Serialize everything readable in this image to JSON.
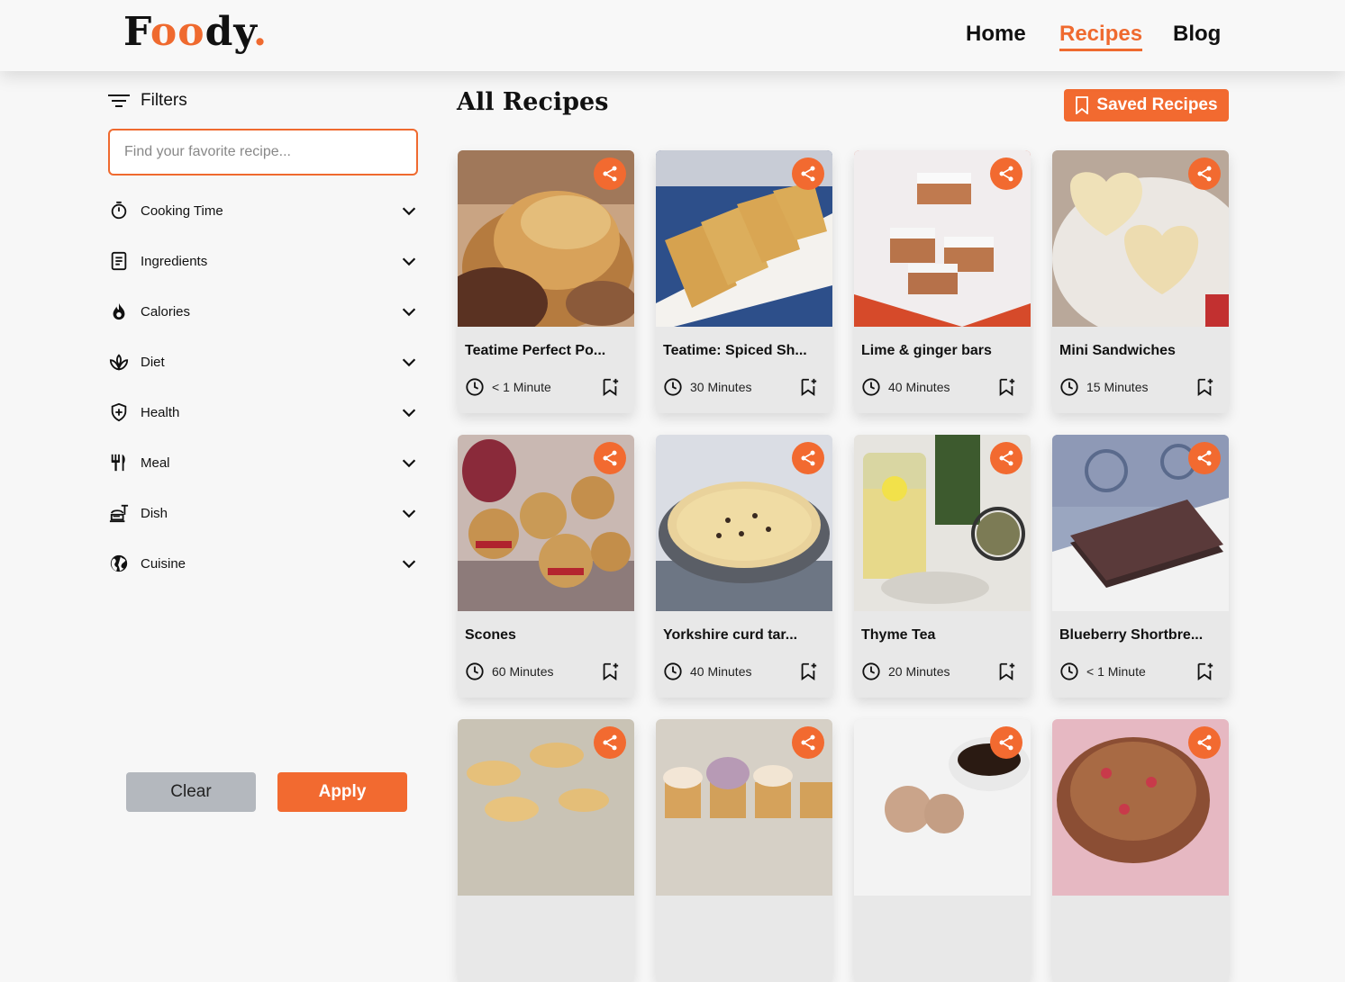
{
  "header": {
    "logo": {
      "pre": "F",
      "o1": "o",
      "o2": "o",
      "post": "dy",
      "dot": "."
    },
    "nav": [
      {
        "label": "Home"
      },
      {
        "label": "Recipes"
      },
      {
        "label": "Blog"
      }
    ]
  },
  "sidebar": {
    "filters_label": "Filters",
    "search_placeholder": "Find your favorite recipe...",
    "filters": [
      {
        "label": "Cooking Time",
        "icon": "timer-icon"
      },
      {
        "label": "Ingredients",
        "icon": "list-icon"
      },
      {
        "label": "Calories",
        "icon": "flame-icon"
      },
      {
        "label": "Diet",
        "icon": "leaf-icon"
      },
      {
        "label": "Health",
        "icon": "shield-icon"
      },
      {
        "label": "Meal",
        "icon": "cutlery-icon"
      },
      {
        "label": "Dish",
        "icon": "dish-icon"
      },
      {
        "label": "Cuisine",
        "icon": "globe-icon"
      }
    ],
    "clear_label": "Clear",
    "apply_label": "Apply"
  },
  "main": {
    "title": "All Recipes",
    "saved_label": "Saved Recipes",
    "recipes": [
      {
        "name": "Teatime Perfect Po...",
        "time": "< 1 Minute"
      },
      {
        "name": "Teatime: Spiced Sh...",
        "time": "30 Minutes"
      },
      {
        "name": "Lime & ginger bars",
        "time": "40 Minutes"
      },
      {
        "name": "Mini Sandwiches",
        "time": "15 Minutes"
      },
      {
        "name": "Scones",
        "time": "60 Minutes"
      },
      {
        "name": "Yorkshire curd tar...",
        "time": "40 Minutes"
      },
      {
        "name": "Thyme Tea",
        "time": "20 Minutes"
      },
      {
        "name": "Blueberry Shortbre...",
        "time": "< 1 Minute"
      },
      {
        "name": "",
        "time": ""
      },
      {
        "name": "",
        "time": ""
      },
      {
        "name": "",
        "time": ""
      },
      {
        "name": "",
        "time": ""
      }
    ]
  },
  "colors": {
    "accent": "#f26a30",
    "card": "#e8e8e8",
    "clear": "#b4b8be"
  }
}
